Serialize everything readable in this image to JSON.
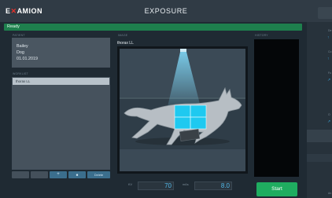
{
  "header": {
    "logo_prefix": "E",
    "logo_x": "✕",
    "logo_suffix": "AMION",
    "title": "EXPOSURE"
  },
  "status": {
    "text": "Ready"
  },
  "columns": {
    "patient": "PATIENT",
    "worklist": "WORKLIST",
    "image": "IMAGE",
    "history": "HISTORY"
  },
  "patient": {
    "name": "Bailey",
    "species": "Dog",
    "dob": "01.01.2019"
  },
  "worklist": {
    "selected_item": "thorax LL"
  },
  "toolbar": {
    "add_icon": "+",
    "delete_icon": "■",
    "label": "Delete"
  },
  "image": {
    "label": "thorax LL"
  },
  "params": {
    "kv_label": "KV",
    "kv_value": "70",
    "mas_label": "mAs",
    "mas_value": "8.0"
  },
  "start": {
    "label": "Start"
  },
  "colors": {
    "accent_green": "#1fad60",
    "status_green": "#1e7f4d",
    "value_blue": "#52b8e8",
    "highlight_cyan": "#1ec9f0"
  },
  "icons": [
    "plus-icon",
    "stop-icon",
    "dog-icon",
    "lamp-icon"
  ]
}
